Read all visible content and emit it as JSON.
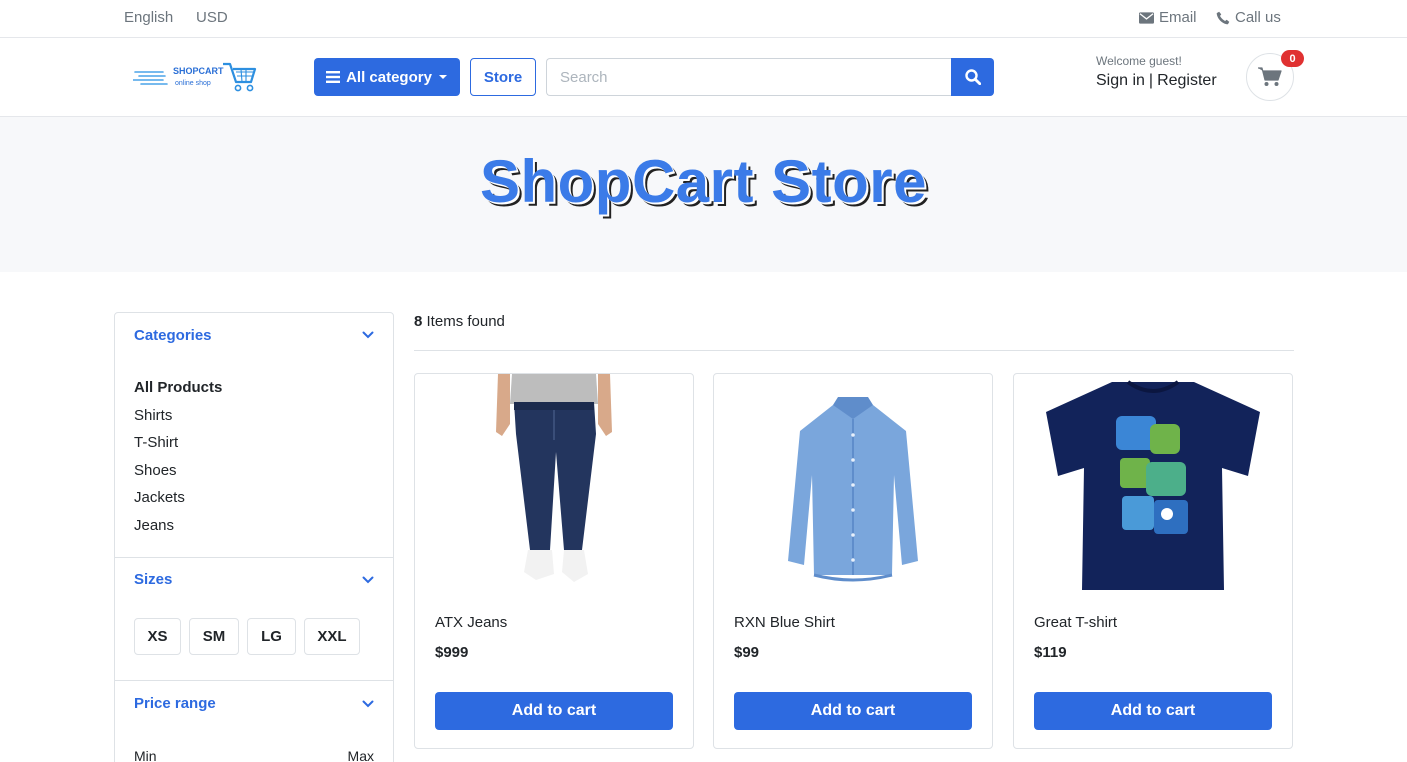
{
  "topbar": {
    "language": "English",
    "currency": "USD",
    "email_label": "Email",
    "call_label": "Call us"
  },
  "header": {
    "logo_text": "SHOPCART",
    "logo_subtext": "online shop",
    "category_button": "All category",
    "store_button": "Store",
    "search_placeholder": "Search",
    "welcome": "Welcome guest!",
    "sign_in": "Sign in",
    "separator": "|",
    "register": "Register",
    "cart_count": "0"
  },
  "hero": {
    "title": "ShopCart Store"
  },
  "sidebar": {
    "categories_title": "Categories",
    "categories": [
      "All Products",
      "Shirts",
      "T-Shirt",
      "Shoes",
      "Jackets",
      "Jeans"
    ],
    "sizes_title": "Sizes",
    "sizes": [
      "XS",
      "SM",
      "LG",
      "XXL"
    ],
    "price_title": "Price range",
    "price_min": "Min",
    "price_max": "Max"
  },
  "results": {
    "count": "8",
    "label": "Items found"
  },
  "products": [
    {
      "name": "ATX Jeans",
      "price": "$999",
      "button": "Add to cart"
    },
    {
      "name": "RXN Blue Shirt",
      "price": "$99",
      "button": "Add to cart"
    },
    {
      "name": "Great T-shirt",
      "price": "$119",
      "button": "Add to cart"
    }
  ],
  "colors": {
    "primary": "#2d6ae0",
    "hero_title": "#3b7be8",
    "badge": "#e03131"
  }
}
